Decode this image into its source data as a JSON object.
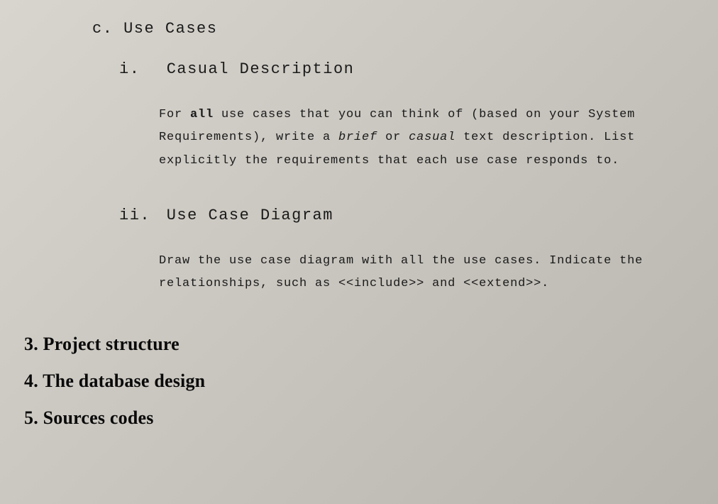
{
  "section_c": {
    "marker": "c.",
    "title": "Use Cases",
    "subsections": [
      {
        "marker": "i.",
        "title": "Casual Description",
        "body_pre": "For ",
        "body_bold1": "all",
        "body_mid1": " use cases that you can think of (based on your System Requirements), write a ",
        "body_italic1": "brief",
        "body_mid2": " or ",
        "body_italic2": "casual",
        "body_post": " text description. List explicitly the requirements that each use case responds to."
      },
      {
        "marker": "ii.",
        "title": "Use Case Diagram",
        "body_pre": "Draw the use case diagram with all the use cases.  Indicate the relationships, ",
        "body_cursor": "such",
        "body_post": " as <<include>> and <<extend>>."
      }
    ]
  },
  "main_items": [
    {
      "marker": "3.",
      "title": "Project structure"
    },
    {
      "marker": "4.",
      "title": "The database design"
    },
    {
      "marker": "5.",
      "title": "Sources codes"
    }
  ]
}
